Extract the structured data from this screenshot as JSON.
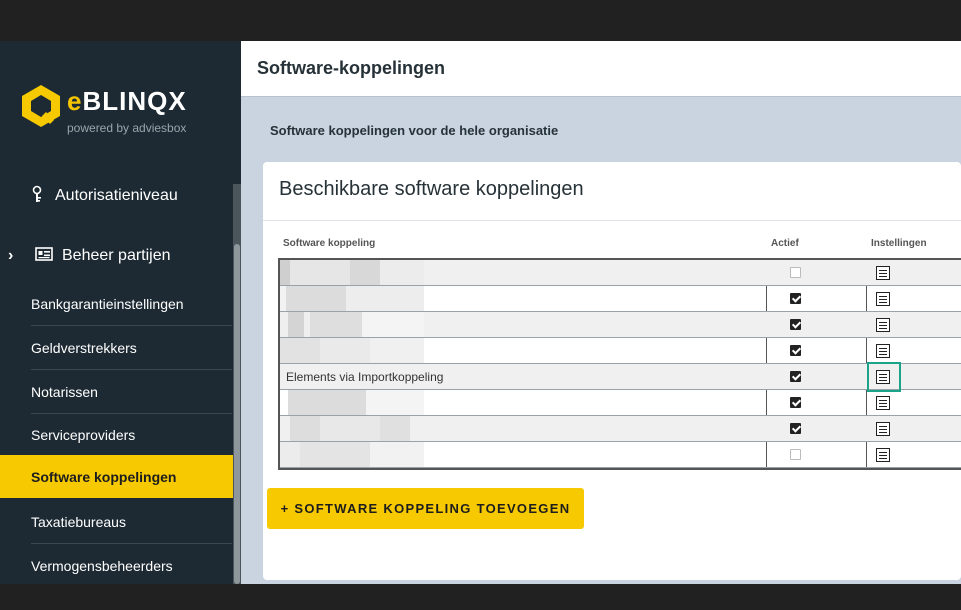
{
  "brand": {
    "name_e": "e",
    "name_rest": "BLINQX",
    "tagline": "powered by adviesbox",
    "accent": "#f6c900"
  },
  "sidebar": {
    "main_items": [
      {
        "label": "Autorisatieniveau",
        "icon": "key-icon"
      },
      {
        "label": "Beheer partijen",
        "icon": "id-card-icon",
        "chevron": "chevron-right-icon"
      }
    ],
    "sub_items": [
      {
        "label": "Bankgarantieinstellingen",
        "active": false
      },
      {
        "label": "Geldverstrekkers",
        "active": false
      },
      {
        "label": "Notarissen",
        "active": false
      },
      {
        "label": "Serviceproviders",
        "active": false
      },
      {
        "label": "Software koppelingen",
        "active": true
      },
      {
        "label": "Taxatiebureaus",
        "active": false
      },
      {
        "label": "Vermogensbeheerders",
        "active": false
      }
    ]
  },
  "header": {
    "title": "Software-koppelingen"
  },
  "page": {
    "subtitle": "Software koppelingen voor de hele organisatie"
  },
  "card": {
    "title": "Beschikbare software koppelingen",
    "columns": {
      "name": "Software koppeling",
      "active": "Actief",
      "settings": "Instellingen"
    },
    "rows": [
      {
        "name": "",
        "active": false
      },
      {
        "name": "",
        "active": true
      },
      {
        "name": "",
        "active": true
      },
      {
        "name": "",
        "active": true
      },
      {
        "name": "Elements via Importkoppeling",
        "active": true,
        "focused": true
      },
      {
        "name": "",
        "active": true
      },
      {
        "name": "",
        "active": true
      },
      {
        "name": "",
        "active": false
      }
    ],
    "add_button": "+ SOFTWARE KOPPELING TOEVOEGEN"
  }
}
